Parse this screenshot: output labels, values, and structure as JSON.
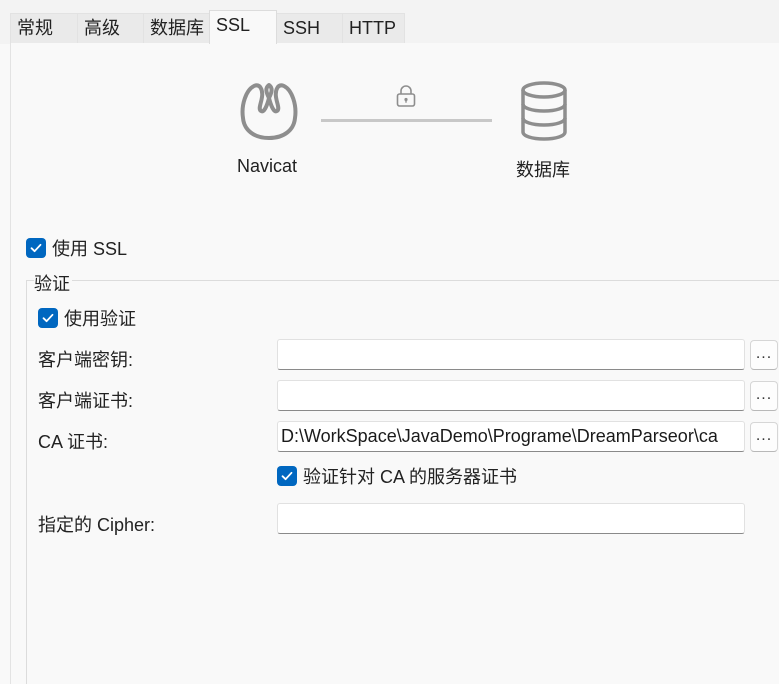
{
  "tabs": [
    {
      "label": "常规"
    },
    {
      "label": "高级"
    },
    {
      "label": "数据库"
    },
    {
      "label": "SSL"
    },
    {
      "label": "SSH"
    },
    {
      "label": "HTTP"
    }
  ],
  "active_tab": "SSL",
  "diagram": {
    "client_label": "Navicat",
    "server_label": "数据库",
    "client_icon": "navicat-logo-icon",
    "server_icon": "database-icon",
    "link_icon": "lock-icon"
  },
  "use_ssl": {
    "label": "使用 SSL",
    "checked": true
  },
  "auth_group": {
    "legend": "验证",
    "use_auth": {
      "label": "使用验证",
      "checked": true
    },
    "client_key": {
      "label": "客户端密钥:",
      "value": ""
    },
    "client_cert": {
      "label": "客户端证书:",
      "value": ""
    },
    "ca_cert": {
      "label": "CA 证书:",
      "value": "D:\\WorkSpace\\JavaDemo\\Programe\\DreamParseor\\ca"
    },
    "verify_ca": {
      "label": "验证针对 CA 的服务器证书",
      "checked": true
    },
    "cipher": {
      "label": "指定的 Cipher:",
      "value": ""
    },
    "browse_label": "..."
  },
  "colors": {
    "accent": "#0067c0",
    "icon_gray": "#8e8e8e"
  }
}
